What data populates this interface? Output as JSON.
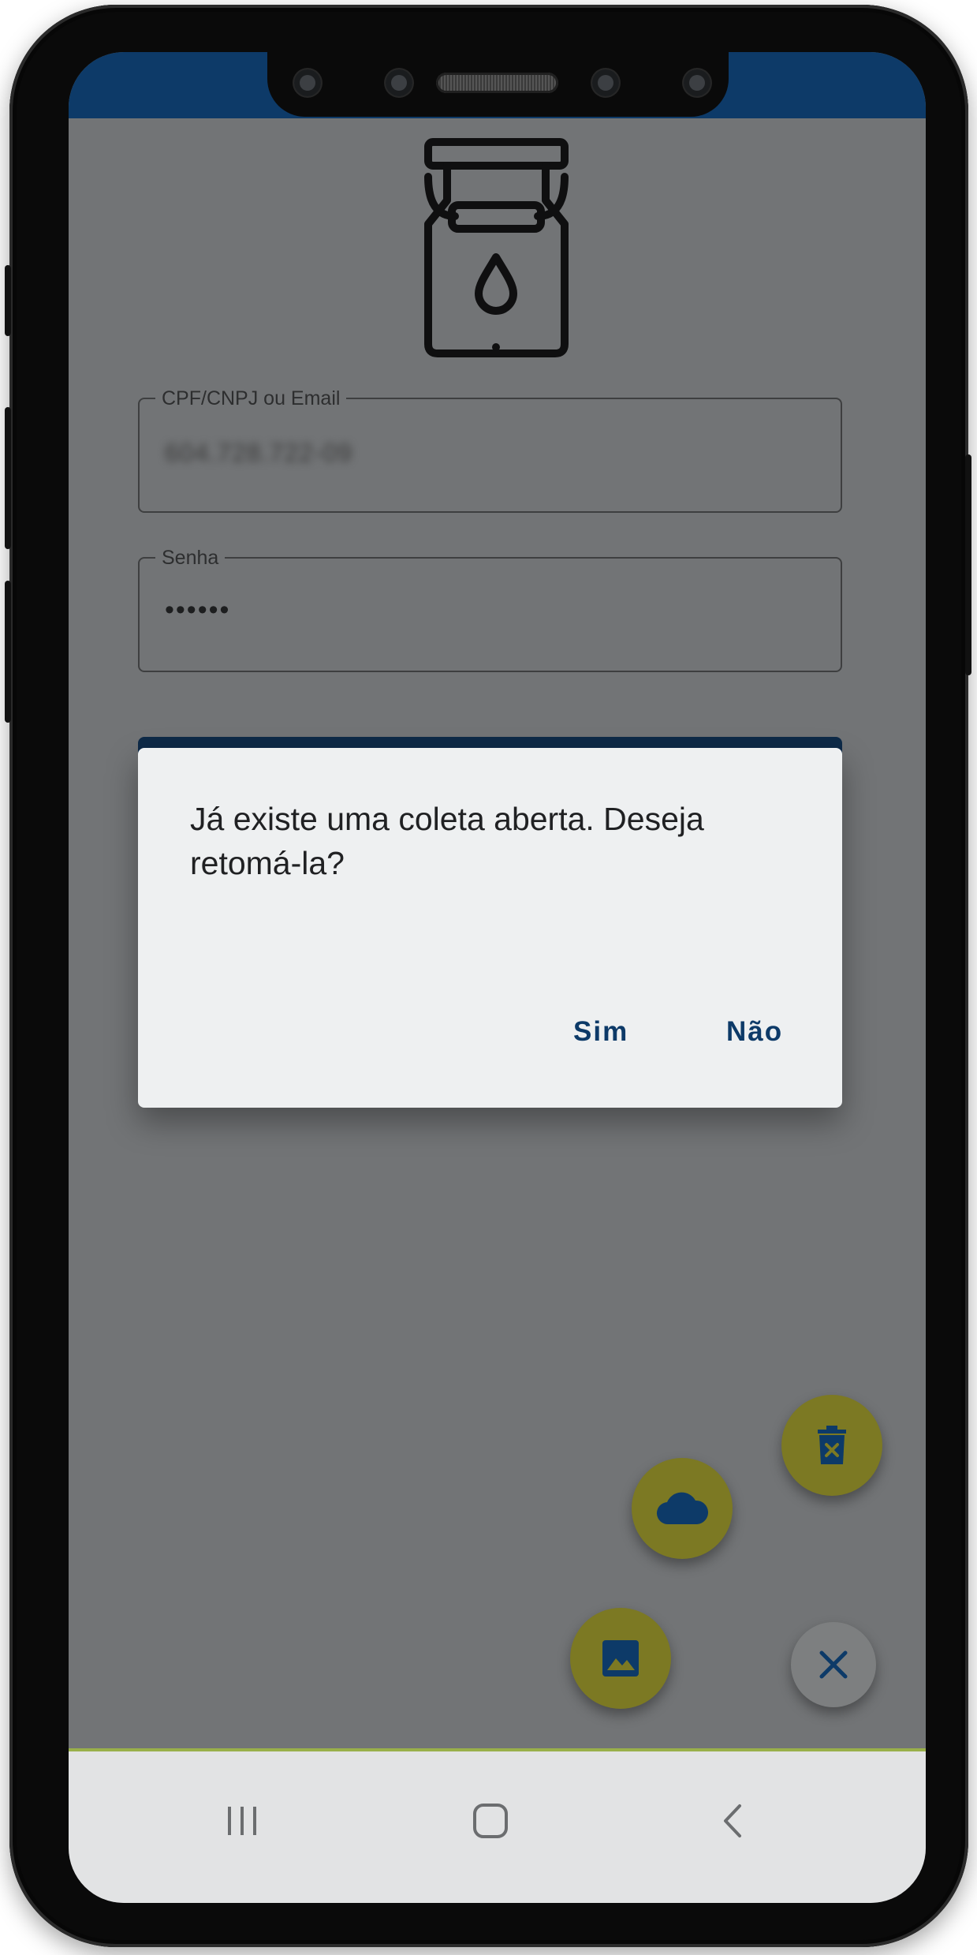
{
  "form": {
    "cpf_label": "CPF/CNPJ ou Email",
    "cpf_value": "604.728.722-09",
    "password_label": "Senha",
    "password_value": "••••••"
  },
  "dialog": {
    "message": "Já existe uma coleta aberta. Deseja retomá-la?",
    "yes_label": "Sim",
    "no_label": "Não"
  },
  "icons": {
    "logo": "milk-can-icon",
    "fab_delete": "delete-icon",
    "fab_cloud": "cloud-icon",
    "fab_image": "image-icon",
    "fab_close": "close-icon",
    "nav_recent": "recent-apps-icon",
    "nav_home": "home-icon",
    "nav_back": "back-icon"
  },
  "colors": {
    "primary": "#0d3a68",
    "fab": "#7c7923",
    "overlay": "#727476",
    "dialog_bg": "#eef0f1"
  }
}
